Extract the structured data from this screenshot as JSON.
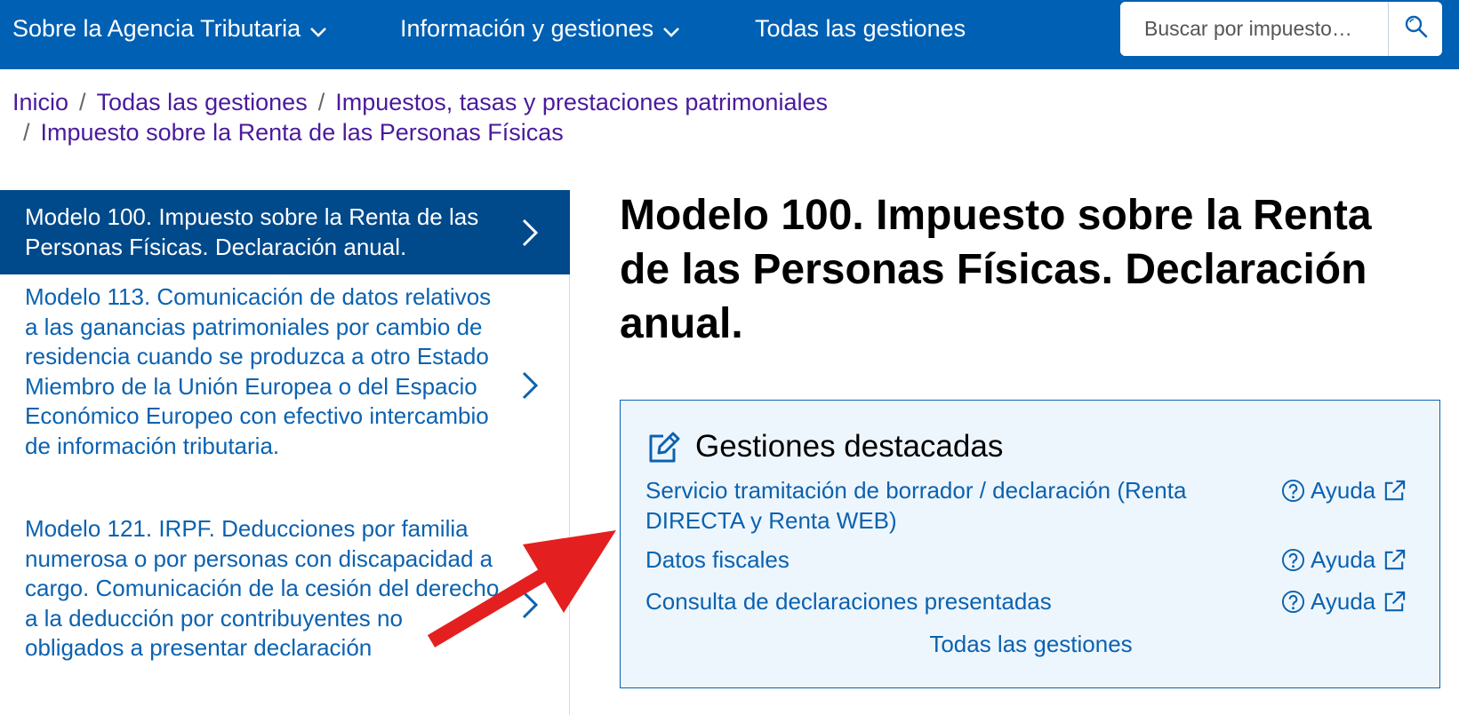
{
  "nav": {
    "item1": "Sobre la Agencia Tributaria",
    "item2": "Información y gestiones",
    "item3": "Todas las gestiones",
    "search_placeholder": "Buscar por impuesto…",
    "chevron_icon": "chevron-down-icon",
    "search_icon": "search-icon"
  },
  "breadcrumb": {
    "items": [
      "Inicio",
      "Todas las gestiones",
      "Impuestos, tasas y prestaciones patrimoniales",
      "Impuesto sobre la Renta de las Personas Físicas"
    ],
    "separator": "/"
  },
  "sidebar": {
    "items": [
      "Modelo 100. Impuesto sobre la Renta de las Personas Físicas. Declaración anual.",
      "Modelo 113. Comunicación de datos relativos a las ganancias patrimoniales por cambio de residencia cuando se produzca a otro Estado Miembro de la Unión Europea o del Espacio Económico Europeo con efectivo intercambio de información tributaria.",
      "Modelo 121. IRPF. Deducciones por familia numerosa o por personas con discapacidad a cargo. Comunicación de la cesión del derecho a la deducción por contribuyentes no obligados a presentar declaración"
    ]
  },
  "main": {
    "title": "Modelo 100. Impuesto sobre la Renta de las Personas Físicas. Declaración anual."
  },
  "featured": {
    "title": "Gestiones destacadas",
    "links": [
      "Servicio tramitación de borrador / declaración (Renta DIRECTA y Renta WEB)",
      "Datos fiscales",
      "Consulta de declaraciones presentadas"
    ],
    "help_label": "Ayuda",
    "all_label": "Todas las gestiones"
  },
  "colors": {
    "nav_bg": "#0060b3",
    "sidebar_active_bg": "#00498a",
    "link": "#0b62b0",
    "breadcrumb_link": "#4b1a9c",
    "featured_bg": "#eef6fd",
    "annotation_arrow": "#e3201f"
  }
}
